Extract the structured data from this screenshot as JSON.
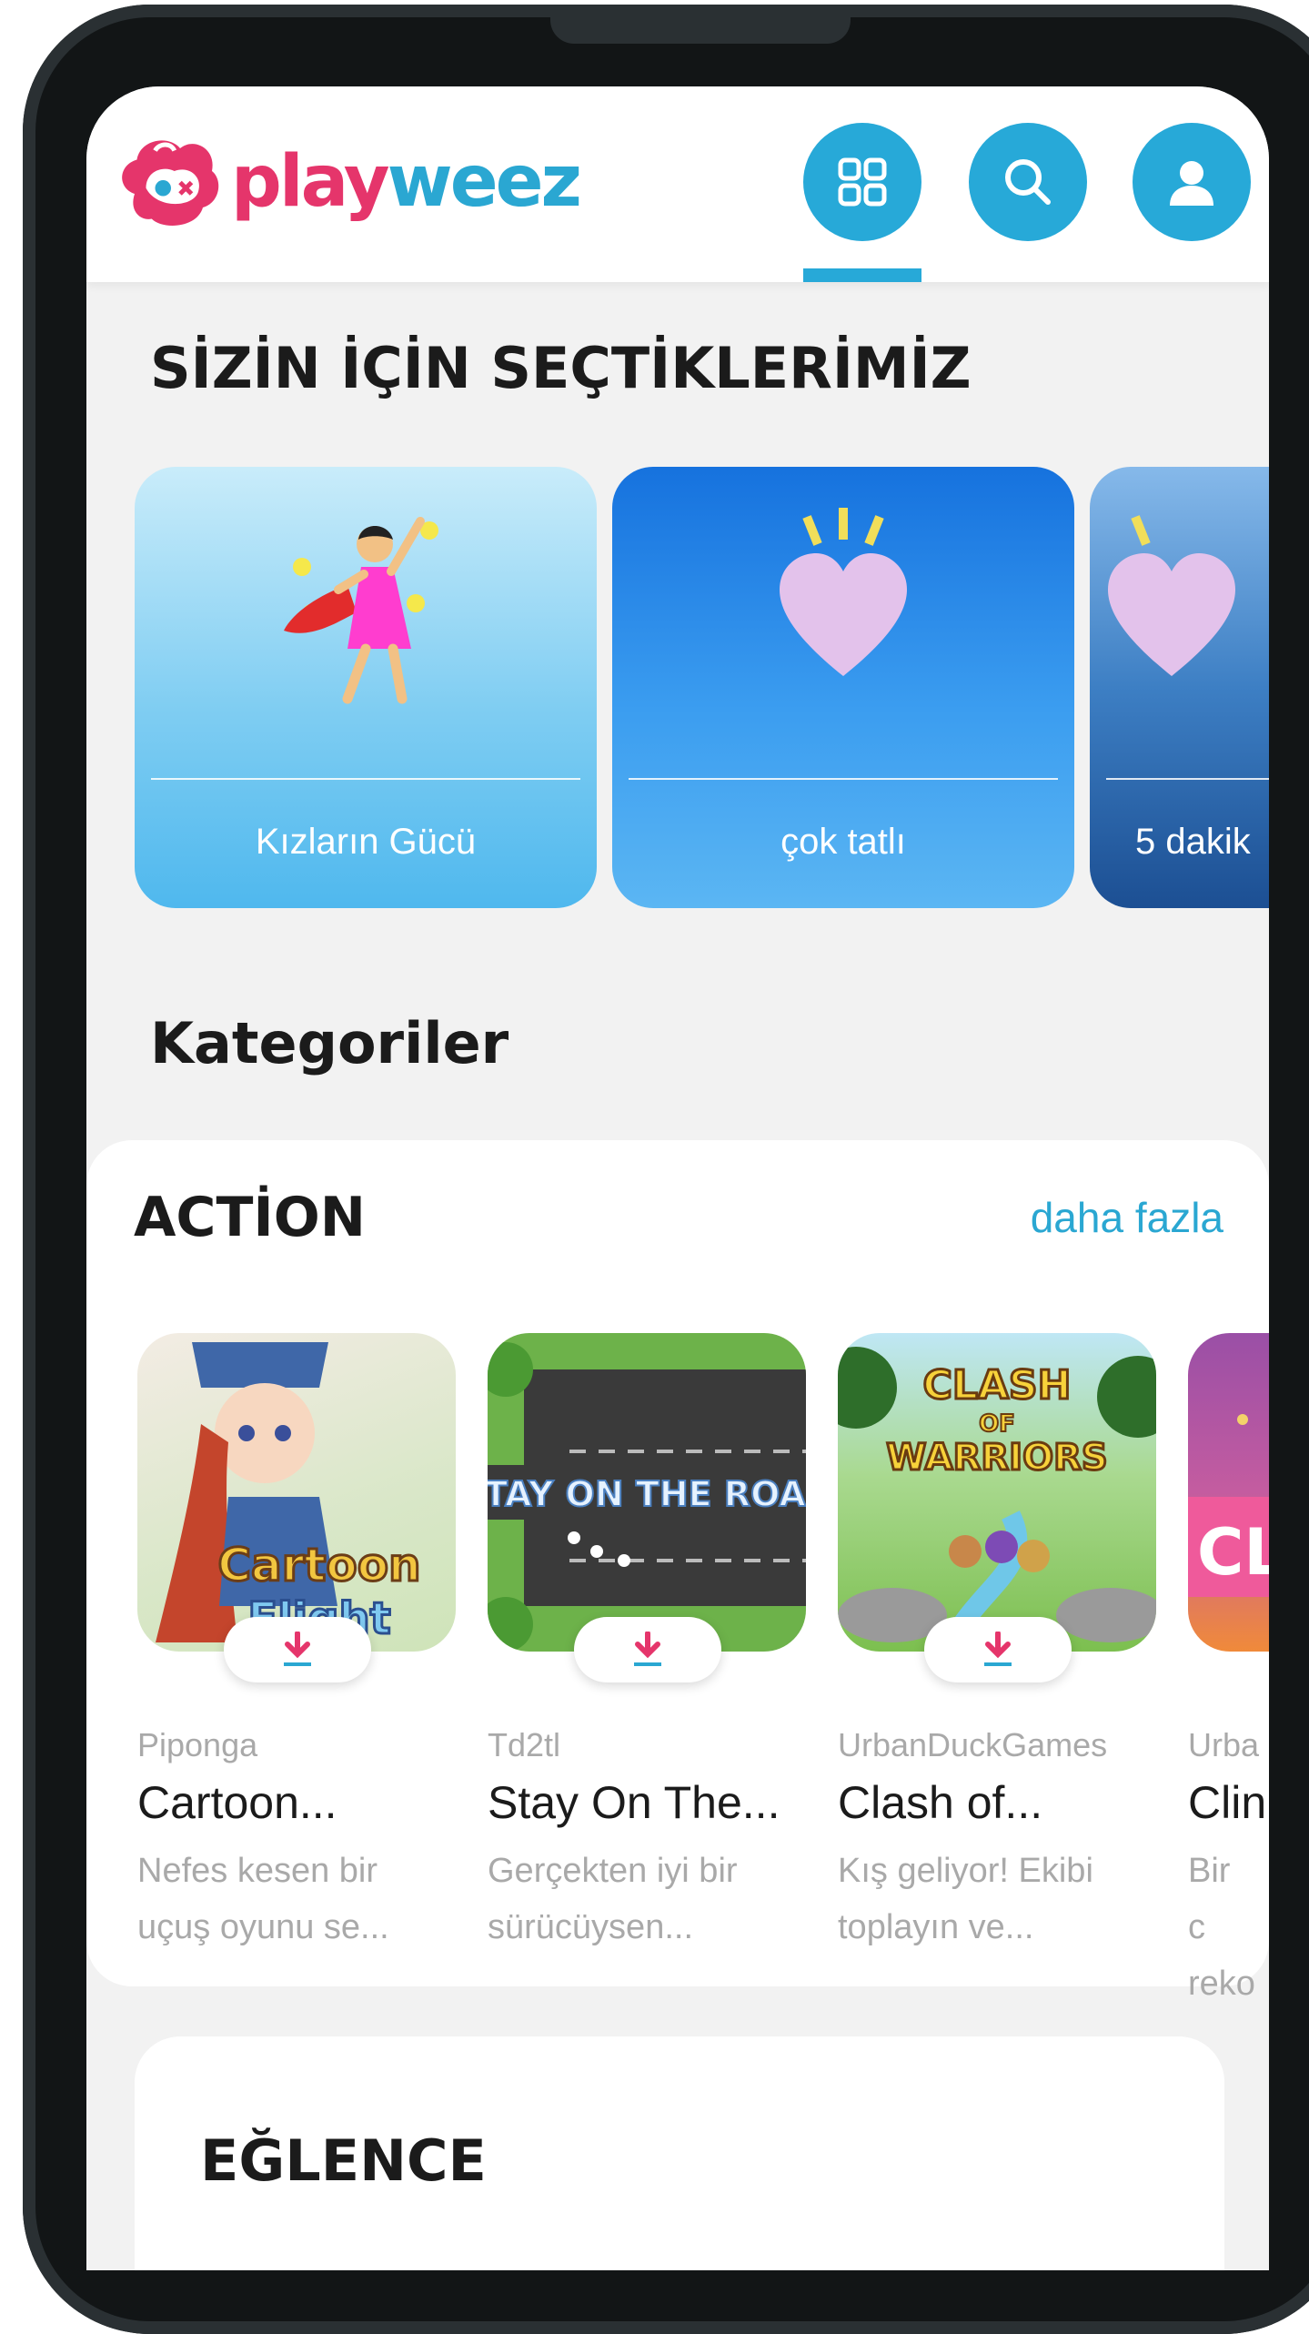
{
  "app": {
    "brand_part1": "play",
    "brand_part2": "weez",
    "brand_colors": {
      "pink": "#e5356b",
      "blue": "#2aa7d2"
    }
  },
  "header": {
    "buttons": [
      {
        "icon": "grid-icon",
        "active": true
      },
      {
        "icon": "search-icon",
        "active": false
      },
      {
        "icon": "user-icon",
        "active": false
      }
    ]
  },
  "picks": {
    "title": "SİZİN İÇİN SEÇTİKLERİMİZ",
    "cards": [
      {
        "label": "Kızların Gücü",
        "icon": "superhero-girl-icon"
      },
      {
        "label": "çok tatlı",
        "icon": "heart-icon"
      },
      {
        "label": "5 dakik",
        "icon": "heart-icon"
      }
    ]
  },
  "categories": {
    "title": "Kategoriler",
    "sections": [
      {
        "title": "ACTİON",
        "more_label": "daha fazla",
        "games": [
          {
            "developer": "Piponga",
            "name": "Cartoon...",
            "desc": "Nefes kesen bir uçuş oyunu se...",
            "thumb_text": "Cartoon Flight"
          },
          {
            "developer": "Td2tl",
            "name": "Stay On The...",
            "desc": "Gerçekten iyi bir sürücüysen...",
            "thumb_text": "STAY ON THE ROAD"
          },
          {
            "developer": "UrbanDuckGames",
            "name": "Clash of...",
            "desc": "Kış geliyor! Ekibi toplayın ve...",
            "thumb_text": "CLASH OF WARRIORS"
          },
          {
            "developer": "Urba",
            "name": "Clin",
            "desc": "Bir c reko",
            "thumb_text": "CL"
          }
        ]
      },
      {
        "title": "EĞLENCE"
      }
    ]
  },
  "accent_color": "#27a9d8"
}
